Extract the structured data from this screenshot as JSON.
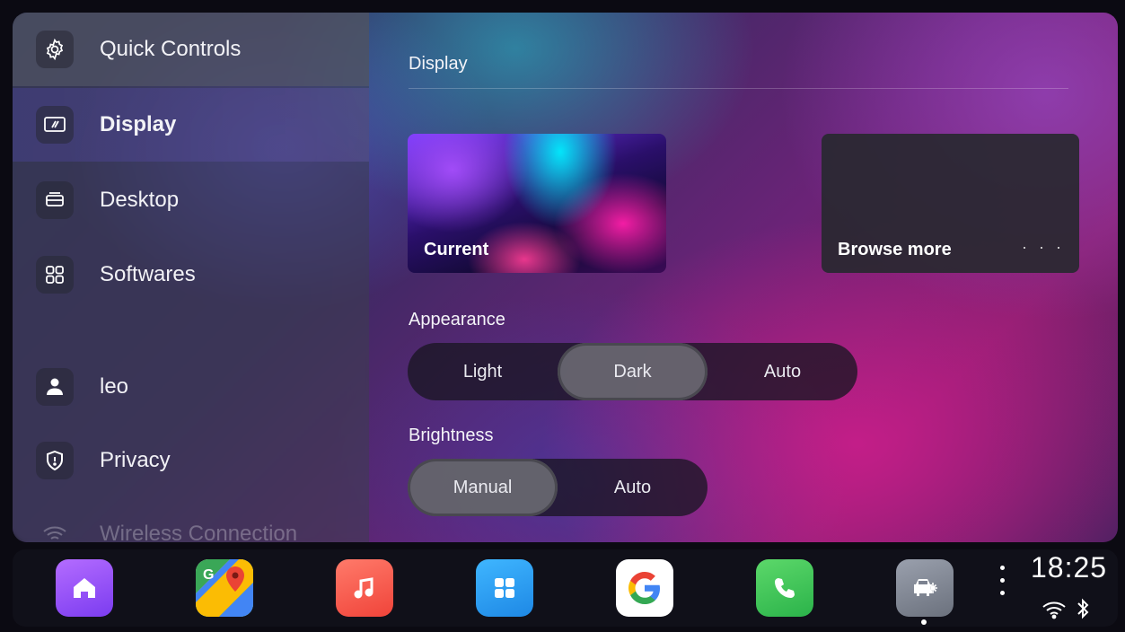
{
  "sidebar": {
    "items": [
      {
        "label": "Quick Controls",
        "icon": "gear-icon"
      },
      {
        "label": "Display",
        "icon": "display-icon"
      },
      {
        "label": "Desktop",
        "icon": "desktop-icon"
      },
      {
        "label": "Softwares",
        "icon": "apps-grid-icon"
      },
      {
        "label": "leo",
        "icon": "user-icon"
      },
      {
        "label": "Privacy",
        "icon": "shield-icon"
      },
      {
        "label": "Wireless Connection",
        "icon": "wifi-icon"
      }
    ]
  },
  "main": {
    "title": "Display",
    "wallpaper_current_label": "Current",
    "wallpaper_more_label": "Browse more",
    "wallpaper_more_dots": "· · ·",
    "appearance": {
      "label": "Appearance",
      "options": [
        "Light",
        "Dark",
        "Auto"
      ],
      "selected": "Dark"
    },
    "brightness": {
      "label": "Brightness",
      "options": [
        "Manual",
        "Auto"
      ],
      "selected": "Manual"
    }
  },
  "dock": {
    "apps": [
      {
        "name": "home",
        "icon": "home-icon"
      },
      {
        "name": "maps",
        "icon": "maps-icon"
      },
      {
        "name": "music",
        "icon": "music-icon"
      },
      {
        "name": "app-library",
        "icon": "grid-icon"
      },
      {
        "name": "google",
        "icon": "google-icon"
      },
      {
        "name": "phone",
        "icon": "phone-icon"
      },
      {
        "name": "car-settings",
        "icon": "car-fan-icon"
      }
    ],
    "time": "18:25",
    "status_icons": [
      "wifi-icon",
      "bluetooth-icon"
    ]
  },
  "colors": {
    "accent_selected": "#6e6e76",
    "segment_bg": "#19162380"
  }
}
